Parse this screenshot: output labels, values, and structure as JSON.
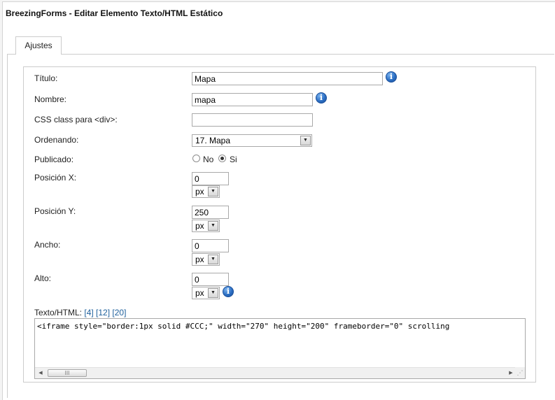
{
  "page": {
    "title": "BreezingForms - Editar Elemento Texto/HTML Estático"
  },
  "tabs": [
    {
      "label": "Ajustes",
      "active": true
    }
  ],
  "form": {
    "titulo": {
      "label": "Título:",
      "value": "Mapa"
    },
    "nombre": {
      "label": "Nombre:",
      "value": "mapa"
    },
    "css_class": {
      "label": "CSS class para <div>:",
      "value": ""
    },
    "ordenando": {
      "label": "Ordenando:",
      "selected": "17. Mapa"
    },
    "publicado": {
      "label": "Publicado:",
      "options": [
        {
          "label": "No",
          "checked": false
        },
        {
          "label": "Si",
          "checked": true
        }
      ]
    },
    "pos_x": {
      "label": "Posición X:",
      "value": "0",
      "unit": "px"
    },
    "pos_y": {
      "label": "Posición Y:",
      "value": "250",
      "unit": "px"
    },
    "ancho": {
      "label": "Ancho:",
      "value": "0",
      "unit": "px"
    },
    "alto": {
      "label": "Alto:",
      "value": "0",
      "unit": "px"
    },
    "texto_html": {
      "label": "Texto/HTML:",
      "links": [
        "[4]",
        "[12]",
        "[20]"
      ],
      "content": "<iframe style=\"border:1px solid #CCC;\" width=\"270\" height=\"200\" frameborder=\"0\" scrolling"
    }
  },
  "icons": {
    "info": "info-icon",
    "dropdown": "chevron-down-icon",
    "scroll_left": "arrow-left-icon",
    "scroll_right": "arrow-right-icon",
    "grip": "resize-grip-icon"
  },
  "glyphs": {
    "info": "i",
    "down": "▼",
    "left": "◀",
    "right": "▶",
    "thumb": "III",
    "grip": "⋰"
  },
  "colors": {
    "link": "#1d5f9b",
    "info_icon": "#2c6fc4",
    "border": "#cccccc"
  }
}
